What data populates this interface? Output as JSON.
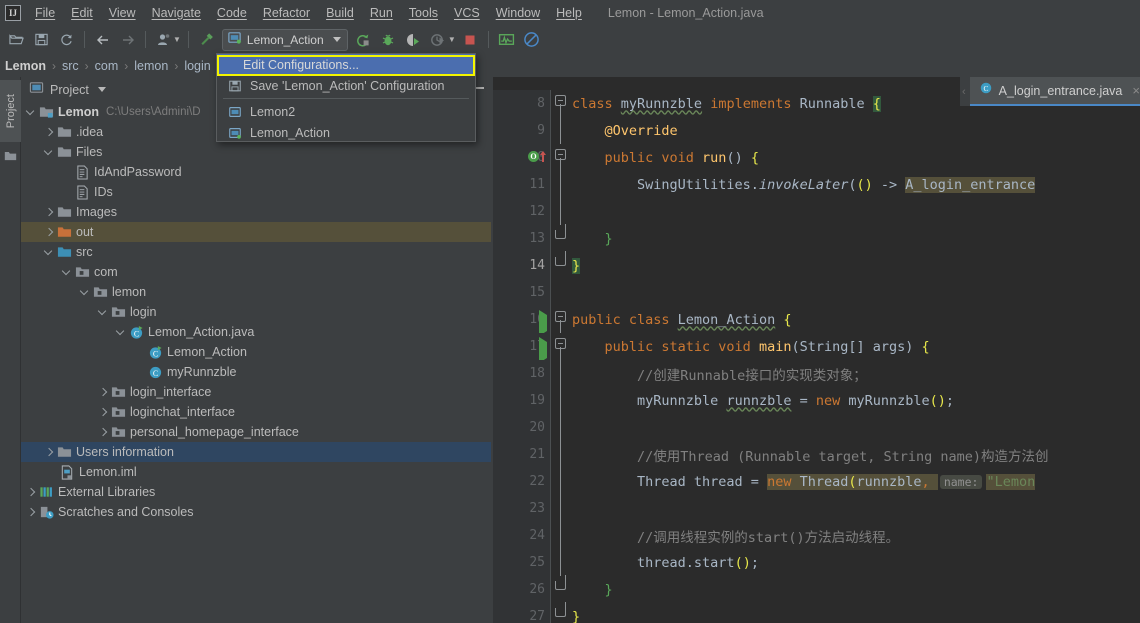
{
  "window": {
    "title": "Lemon - Lemon_Action.java",
    "logo": "ij-logo"
  },
  "menubar": {
    "items": [
      {
        "label": "File"
      },
      {
        "label": "Edit"
      },
      {
        "label": "View"
      },
      {
        "label": "Navigate"
      },
      {
        "label": "Code"
      },
      {
        "label": "Refactor"
      },
      {
        "label": "Build"
      },
      {
        "label": "Run"
      },
      {
        "label": "Tools"
      },
      {
        "label": "VCS"
      },
      {
        "label": "Window"
      },
      {
        "label": "Help"
      }
    ]
  },
  "toolbar": {
    "run_config": "Lemon_Action",
    "icons": [
      "open-folder-icon",
      "save-all-icon",
      "sync-refresh-icon",
      "back-arrow-icon",
      "forward-arrow-icon",
      "profile-user-icon",
      "build-hammer-icon",
      "run-icon",
      "debug-icon",
      "run-with-coverage-icon",
      "profiler-icon",
      "stop-icon",
      "search-everywhere-icon",
      "no-entry-icon"
    ]
  },
  "breadcrumb": {
    "items": [
      "Lemon",
      "src",
      "com",
      "lemon",
      "login"
    ],
    "separator": "›"
  },
  "popup": {
    "selected": "Edit Configurations...",
    "rows": [
      {
        "label": "Save 'Lemon_Action' Configuration",
        "icon": "save-icon"
      },
      {
        "label": "Lemon2",
        "icon": "run-config-icon"
      },
      {
        "label": "Lemon_Action",
        "icon": "run-config-active-icon"
      }
    ],
    "highlight_color": "#f3f500",
    "selection_color": "#4b6eaf"
  },
  "sidebar": {
    "vertical_tab": "Project",
    "header": "Project",
    "tree": [
      {
        "label": "Lemon",
        "path": "C:\\Users\\Admini\\D",
        "depth": 0,
        "icon": "module-folder-icon",
        "chev": "open",
        "bold": true
      },
      {
        "label": ".idea",
        "depth": 1,
        "icon": "folder-icon",
        "chev": "closed"
      },
      {
        "label": "Files",
        "depth": 1,
        "icon": "folder-icon",
        "chev": "open"
      },
      {
        "label": "IdAndPassword",
        "depth": 2,
        "icon": "text-file-icon",
        "chev": "none"
      },
      {
        "label": "IDs",
        "depth": 2,
        "icon": "text-file-icon",
        "chev": "none"
      },
      {
        "label": "Images",
        "depth": 1,
        "icon": "folder-icon",
        "chev": "closed"
      },
      {
        "label": "out",
        "depth": 1,
        "icon": "excluded-folder-icon",
        "chev": "closed",
        "state": "olive"
      },
      {
        "label": "src",
        "depth": 1,
        "icon": "source-folder-icon",
        "chev": "open"
      },
      {
        "label": "com",
        "depth": 2,
        "icon": "package-icon",
        "chev": "open"
      },
      {
        "label": "lemon",
        "depth": 3,
        "icon": "package-icon",
        "chev": "open"
      },
      {
        "label": "login",
        "depth": 4,
        "icon": "package-icon",
        "chev": "open"
      },
      {
        "label": "Lemon_Action.java",
        "depth": 5,
        "icon": "java-runnable-class-icon",
        "chev": "open"
      },
      {
        "label": "Lemon_Action",
        "depth": 6,
        "icon": "java-runnable-class-icon",
        "chev": "none"
      },
      {
        "label": "myRunnzble",
        "depth": 6,
        "icon": "java-class-icon",
        "chev": "none"
      },
      {
        "label": "login_interface",
        "depth": 4,
        "icon": "package-icon",
        "chev": "closed"
      },
      {
        "label": "loginchat_interface",
        "depth": 4,
        "icon": "package-icon",
        "chev": "closed"
      },
      {
        "label": "personal_homepage_interface",
        "depth": 4,
        "icon": "package-icon",
        "chev": "closed"
      },
      {
        "label": "Users information",
        "depth": 1,
        "icon": "folder-icon",
        "chev": "closed",
        "state": "blue"
      },
      {
        "label": "Lemon.iml",
        "depth": 1,
        "icon": "iml-file-icon",
        "chev": "none"
      },
      {
        "label": "External Libraries",
        "depth": 0,
        "icon": "libraries-icon",
        "chev": "closed"
      },
      {
        "label": "Scratches and Consoles",
        "depth": 0,
        "icon": "scratches-icon",
        "chev": "closed"
      }
    ]
  },
  "editor": {
    "tab": {
      "label": "A_login_entrance.java",
      "icon": "java-class-icon",
      "close": "×"
    },
    "lines": [
      {
        "num": "8",
        "marker": "none",
        "fold": "minus-start"
      },
      {
        "num": "9",
        "marker": "none",
        "fold": "line"
      },
      {
        "num": "10",
        "marker": "override-arrow",
        "fold": "minus"
      },
      {
        "num": "11",
        "marker": "none",
        "fold": "line"
      },
      {
        "num": "12",
        "marker": "none",
        "fold": "line"
      },
      {
        "num": "13",
        "marker": "none",
        "fold": "end"
      },
      {
        "num": "14",
        "marker": "none",
        "fold": "end"
      },
      {
        "num": "15",
        "marker": "none",
        "fold": "none"
      },
      {
        "num": "16",
        "marker": "run",
        "fold": "minus-start"
      },
      {
        "num": "17",
        "marker": "run",
        "fold": "minus"
      },
      {
        "num": "18",
        "marker": "none",
        "fold": "line"
      },
      {
        "num": "19",
        "marker": "none",
        "fold": "line"
      },
      {
        "num": "20",
        "marker": "none",
        "fold": "line"
      },
      {
        "num": "21",
        "marker": "none",
        "fold": "line"
      },
      {
        "num": "22",
        "marker": "none",
        "fold": "line"
      },
      {
        "num": "23",
        "marker": "none",
        "fold": "line"
      },
      {
        "num": "24",
        "marker": "none",
        "fold": "line"
      },
      {
        "num": "25",
        "marker": "none",
        "fold": "line"
      },
      {
        "num": "26",
        "marker": "none",
        "fold": "end"
      },
      {
        "num": "27",
        "marker": "none",
        "fold": "end"
      }
    ],
    "code": {
      "l8": "class myRunnzble implements Runnable {",
      "l9": "@Override",
      "l10": "public void run() {",
      "l11": "SwingUtilities.invokeLater(() -> A_login_entrance",
      "l13": "}",
      "l14": "}",
      "l16": "public class Lemon_Action {",
      "l17": "public static void main(String[] args) {",
      "l18": "//创建Runnable接口的实现类对象；",
      "l19": "myRunnzble runnzble = new myRunnzble();",
      "l21": "//使用Thread (Runnable target, String name)构造方法创",
      "l22": "Thread thread = new Thread(runnzble,",
      "l22_hint": "name:",
      "l22_str": "\"Lemon",
      "l24": "//调用线程实例的start()方法启动线程。",
      "l25": "thread.start();",
      "l26": "}",
      "l27": "}"
    }
  },
  "colors": {
    "panel_bg": "#3c3f41",
    "editor_bg": "#2b2b2b",
    "gutter_bg": "#313335",
    "accent_blue": "#4b6eaf",
    "tab_underline": "#4a88c7",
    "selection_olive": "#55503a",
    "selection_blue": "#2f4661",
    "highlight_yellow": "#f3f500",
    "keyword_orange": "#cc7832",
    "string_green": "#6a8759",
    "method_yellow": "#ffc66d",
    "comment_gray": "#808080",
    "text_default": "#a9b7c6"
  }
}
